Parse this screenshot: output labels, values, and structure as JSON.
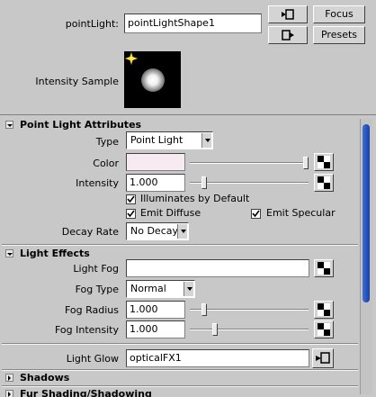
{
  "header": {
    "point_light_label": "pointLight:",
    "point_light_value": "pointLightShape1",
    "focus_label": "Focus",
    "presets_label": "Presets",
    "intensity_sample_label": "Intensity Sample"
  },
  "point_light_attributes": {
    "title": "Point Light Attributes",
    "type_label": "Type",
    "type_value": "Point Light",
    "color_label": "Color",
    "color_value": "#f7eaf0",
    "color_slider_fraction": 1.0,
    "intensity_label": "Intensity",
    "intensity_value": "1.000",
    "intensity_slider_fraction": 0.1,
    "illuminates_label": "Illuminates by Default",
    "illuminates_checked": true,
    "emit_diffuse_label": "Emit Diffuse",
    "emit_diffuse_checked": true,
    "emit_specular_label": "Emit Specular",
    "emit_specular_checked": true,
    "decay_rate_label": "Decay Rate",
    "decay_rate_value": "No Decay"
  },
  "light_effects": {
    "title": "Light Effects",
    "light_fog_label": "Light Fog",
    "light_fog_value": "",
    "fog_type_label": "Fog Type",
    "fog_type_value": "Normal",
    "fog_radius_label": "Fog Radius",
    "fog_radius_value": "1.000",
    "fog_radius_slider_fraction": 0.1,
    "fog_intensity_label": "Fog Intensity",
    "fog_intensity_value": "1.000",
    "fog_intensity_slider_fraction": 0.2,
    "light_glow_label": "Light Glow",
    "light_glow_value": "opticalFX1"
  },
  "sections": {
    "shadows_title": "Shadows",
    "fur_title": "Fur Shading/Shadowing"
  },
  "icons": {
    "map": "checker-map-icon",
    "input_connection": "input-connection-icon",
    "output_connection": "output-connection-icon",
    "sample_star": "light-star-icon"
  }
}
